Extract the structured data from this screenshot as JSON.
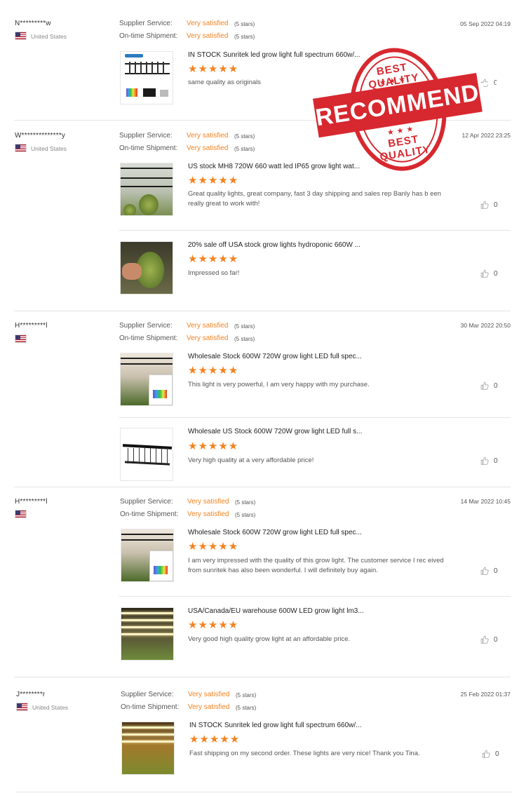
{
  "labels": {
    "supplier_service": "Supplier Service:",
    "ontime_shipment": "On-time Shipment:",
    "very_satisfied": "Very satisfied",
    "five_stars": "(5 stars)",
    "stars_glyph": "★★★★★"
  },
  "stamp": {
    "top": "BEST QUALITY",
    "main": "RECOMMENDED",
    "bottom": "BEST QUALITY",
    "stars": "★★★"
  },
  "reviews": [
    {
      "user": "N*********w",
      "country": "United States",
      "date": "05 Sep 2022 04:19",
      "items": [
        {
          "title": "IN STOCK Sunritek led grow light full spectrum 660w/...",
          "comment": "same quality as originals",
          "likes": "0"
        }
      ]
    },
    {
      "user": "W**************y",
      "country": "United States",
      "date": "12 Apr 2022 23:25",
      "items": [
        {
          "title": "US stock MH8 720W 660 watt led IP65 grow light wat...",
          "comment": "Great quality lights, great company, fast 3 day shipping and sales rep Banly has b een really great to work with!",
          "likes": "0"
        },
        {
          "title": "20% sale off USA stock grow lights hydroponic 660W ...",
          "comment": "Impressed so far!",
          "likes": "0"
        }
      ]
    },
    {
      "user": "H*********l",
      "country": "",
      "date": "30 Mar 2022 20:50",
      "items": [
        {
          "title": "Wholesale Stock 600W 720W grow light LED full spec...",
          "comment": "This light is very powerful, I am very happy with my purchase.",
          "likes": "0"
        },
        {
          "title": "Wholesale US Stock 600W 720W grow light LED full s...",
          "comment": "Very high quality at a very affordable price!",
          "likes": "0"
        }
      ]
    },
    {
      "user": "H*********l",
      "country": "",
      "date": "14 Mar 2022 10:45",
      "items": [
        {
          "title": "Wholesale Stock 600W 720W grow light LED full spec...",
          "comment": "I am very impressed with the quality of this grow light. The customer service I rec eived from sunritek has also been wonderful. I will definitely buy again.",
          "likes": "0"
        },
        {
          "title": "USA/Canada/EU warehouse 600W LED grow light lm3...",
          "comment": "Very good high quality grow light at an affordable price.",
          "likes": "0"
        }
      ]
    },
    {
      "user": "J********r",
      "country": "United States",
      "date": "25 Feb 2022 01:37",
      "items": [
        {
          "title": "IN STOCK Sunritek led grow light full spectrum 660w/...",
          "comment": "Fast shipping on my second order. These lights are very nice! Thank you Tina.",
          "likes": "0"
        }
      ]
    }
  ]
}
